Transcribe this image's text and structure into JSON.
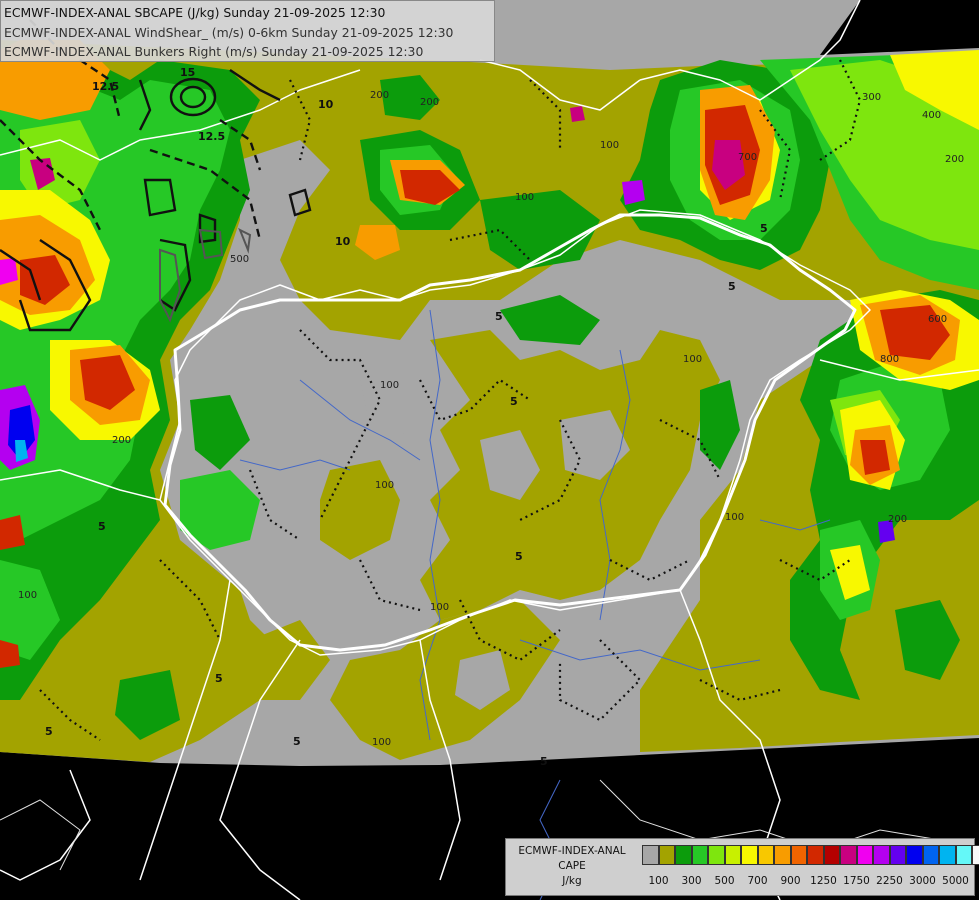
{
  "title": {
    "line1": "ECMWF-INDEX-ANAL SBCAPE (J/kg) Sunday 21-09-2025 12:30",
    "line2": "ECMWF-INDEX-ANAL WindShear_ (m/s) 0-6km Sunday 21-09-2025 12:30",
    "line3": "ECMWF-INDEX-ANAL Bunkers Right (m/s) Sunday 21-09-2025 12:30"
  },
  "legend": {
    "line1": "ECMWF-INDEX-ANAL",
    "line2": "CAPE",
    "line3": "J/kg",
    "colors": [
      "#a7a7a7",
      "#a3a300",
      "#0c9c0c",
      "#26c826",
      "#7ee60e",
      "#c8f000",
      "#f8f800",
      "#f8c800",
      "#f89c00",
      "#f06400",
      "#d22800",
      "#b40000",
      "#c80080",
      "#f000f0",
      "#b400f0",
      "#6400f0",
      "#0000f0",
      "#0064f0",
      "#00b4f0",
      "#64f8f8",
      "#f8f8f8"
    ],
    "ticks": [
      "100",
      "300",
      "500",
      "700",
      "900",
      "1250",
      "1750",
      "2250",
      "3000",
      "5000"
    ]
  },
  "map_labels": {
    "cape": [
      "100",
      "200",
      "300",
      "400",
      "500",
      "600",
      "700",
      "800"
    ],
    "shear": [
      "5",
      "10",
      "12.5",
      "15"
    ]
  }
}
